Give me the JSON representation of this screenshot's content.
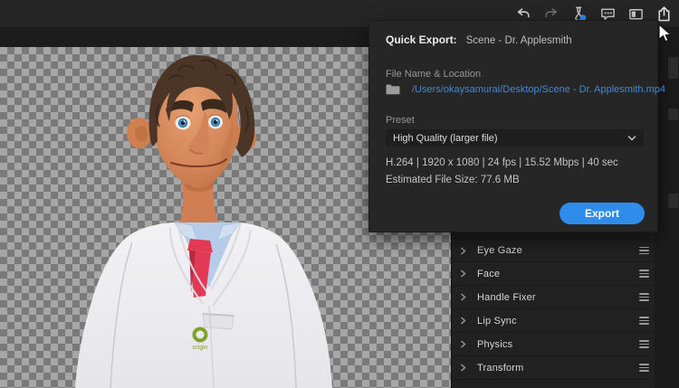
{
  "toolbar": {
    "icons": [
      {
        "name": "undo-icon"
      },
      {
        "name": "redo-icon"
      },
      {
        "name": "experiments-flask-icon",
        "badge_color": "#2e8ceb"
      },
      {
        "name": "feedback-bubble-icon"
      },
      {
        "name": "panel-layout-icon"
      },
      {
        "name": "share-export-icon"
      }
    ]
  },
  "quick_export": {
    "title_label": "Quick Export:",
    "scene_name": "Scene - Dr. Applesmith",
    "file_section_label": "File Name & Location",
    "file_path": "/Users/okaysamurai/Desktop/Scene - Dr. Applesmith.mp4",
    "preset_label": "Preset",
    "preset_value": "High Quality (larger file)",
    "specs_line": "H.264 | 1920 x 1080 | 24 fps | 15.52 Mbps | 40 sec",
    "estimated_size_line": "Estimated File Size: 77.6 MB",
    "export_button_label": "Export",
    "colors": {
      "accent": "#2e8ceb",
      "link": "#4088d9"
    }
  },
  "properties_panel": {
    "rows": [
      {
        "label": "Eye Gaze"
      },
      {
        "label": "Face"
      },
      {
        "label": "Handle Fixer"
      },
      {
        "label": "Lip Sync"
      },
      {
        "label": "Physics"
      },
      {
        "label": "Transform"
      }
    ]
  },
  "scene": {
    "transparency_checker": {
      "light": "#a6a6a6",
      "dark": "#7a7a7a"
    },
    "character": {
      "logo_text": "origin",
      "colors": {
        "skin": "#d98d60",
        "hair": "#4a3526",
        "coat": "#ecebee",
        "shirt": "#b7cce9",
        "tie": "#e23a55",
        "logo": "#7ea32b"
      }
    }
  }
}
